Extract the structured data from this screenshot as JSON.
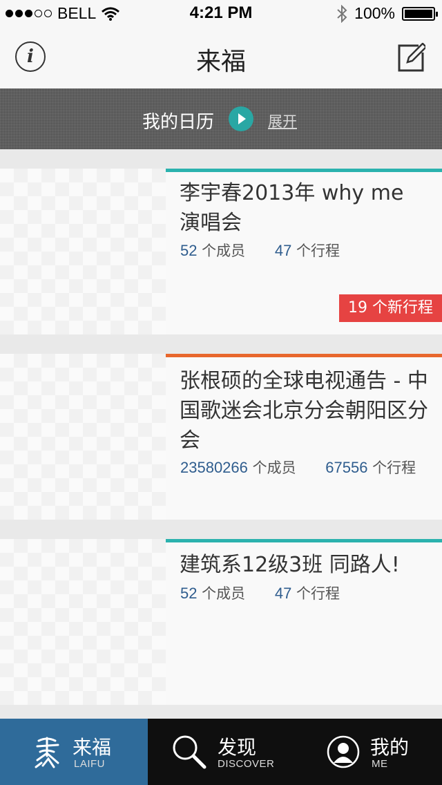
{
  "status_bar": {
    "carrier": "BELL",
    "time": "4:21 PM",
    "battery": "100%",
    "signal_bars_filled": 3,
    "signal_bars_total": 5
  },
  "nav": {
    "title": "来福",
    "info_icon": "info-icon",
    "compose_icon": "compose-icon"
  },
  "calendar": {
    "title": "我的日历",
    "expand": "展开",
    "accent": "#29a7a4"
  },
  "groups": [
    {
      "title": "李宇春2013年 why me 演唱会",
      "members": "52",
      "members_label": "个成员",
      "events": "47",
      "events_label": "个行程",
      "badge": "19 个新行程",
      "accent": "#2bb2ae"
    },
    {
      "title": "张根硕的全球电视通告 - 中国歌迷会北京分会朝阳区分会",
      "members": "23580266",
      "members_label": "个成员",
      "events": "67556",
      "events_label": "个行程",
      "badge": "",
      "accent": "#e8672d"
    },
    {
      "title": "建筑系12级3班 同路人!",
      "members": "52",
      "members_label": "个成员",
      "events": "47",
      "events_label": "个行程",
      "badge": "",
      "accent": "#2bb2ae"
    }
  ],
  "tabs": [
    {
      "label": "来福",
      "sub": "LAIFU",
      "icon": "laifu-logo-icon",
      "active": true
    },
    {
      "label": "发现",
      "sub": "DISCOVER",
      "icon": "search-icon",
      "active": false
    },
    {
      "label": "我的",
      "sub": "ME",
      "icon": "user-avatar-icon",
      "active": false
    }
  ],
  "colors": {
    "badge": "#e64342",
    "stat_number": "#2f5d8e",
    "tab_active": "#2f6b9a"
  }
}
